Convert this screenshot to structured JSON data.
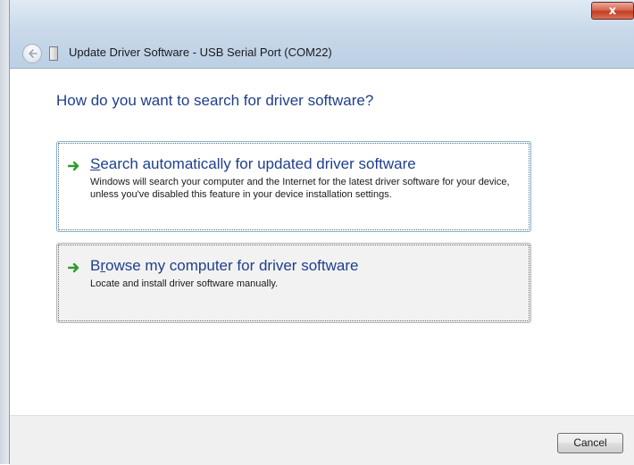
{
  "window": {
    "title": "Update Driver Software - USB Serial Port (COM22)",
    "close_label": "x"
  },
  "main": {
    "heading": "How do you want to search for driver software?",
    "options": [
      {
        "accel": "S",
        "title_rest": "earch automatically for updated driver software",
        "description": "Windows will search your computer and the Internet for the latest driver software for your device, unless you've disabled this feature in your device installation settings.",
        "icon": "green-arrow-icon"
      },
      {
        "title_pre": "B",
        "accel": "r",
        "title_rest": "owse my computer for driver software",
        "description": "Locate and install driver software manually.",
        "icon": "green-arrow-icon"
      }
    ]
  },
  "footer": {
    "cancel_label": "Cancel"
  },
  "colors": {
    "link_blue": "#1f3f8c",
    "arrow_green": "#2e9a2e",
    "close_red": "#c13f22"
  }
}
